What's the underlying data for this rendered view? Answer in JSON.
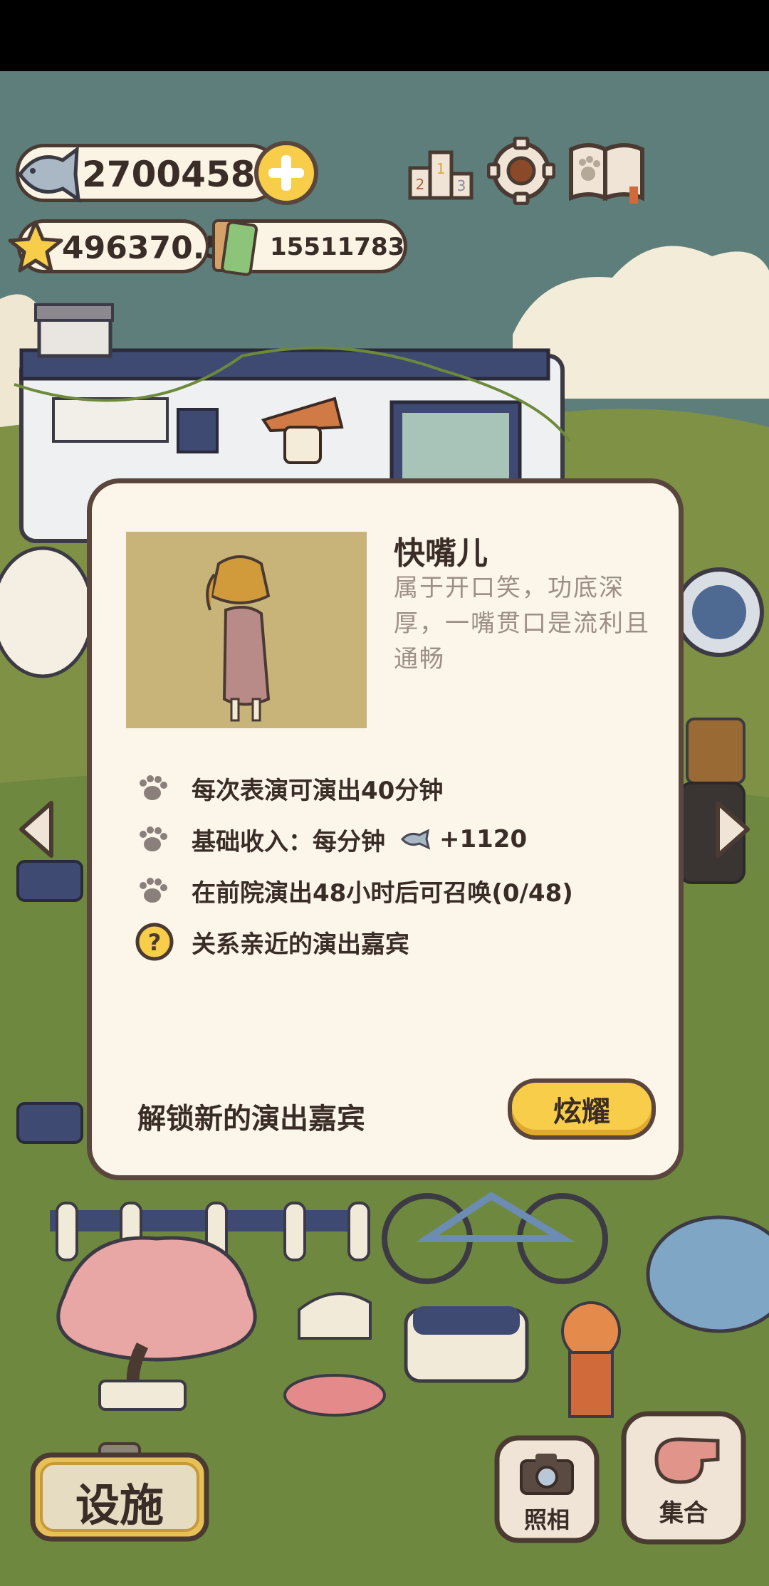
{
  "currency": {
    "fish": "2700458",
    "stars": "496370.5",
    "tickets": "15511783"
  },
  "icons": {
    "fish": "fish-icon",
    "add": "plus-icon",
    "ranking": "podium-icon",
    "settings": "gear-icon",
    "book": "paw-book-icon",
    "star": "star-icon",
    "ticket": "ticket-icon",
    "camera": "camera-icon",
    "whistle": "whistle-icon",
    "paw": "paw-icon",
    "question": "question-icon"
  },
  "modal": {
    "name": "快嘴儿",
    "description": "属于开口笑，功底深厚，一嘴贯口是流利且通畅",
    "rows": [
      {
        "text": "每次表演可演出40分钟"
      },
      {
        "text": "基础收入：每分钟",
        "suffix": "+1120"
      },
      {
        "text": "在前院演出48小时后可召唤(0/48)"
      },
      {
        "text": "关系亲近的演出嘉宾"
      }
    ],
    "unlock_label": "解锁新的演出嘉宾",
    "show_button": "炫耀"
  },
  "bottom": {
    "facilities": "设施",
    "photo": "照相",
    "gather": "集合"
  },
  "colors": {
    "accent_yellow": "#f7cd4a",
    "outline": "#4a3a32",
    "panel": "#fbf5ea"
  }
}
